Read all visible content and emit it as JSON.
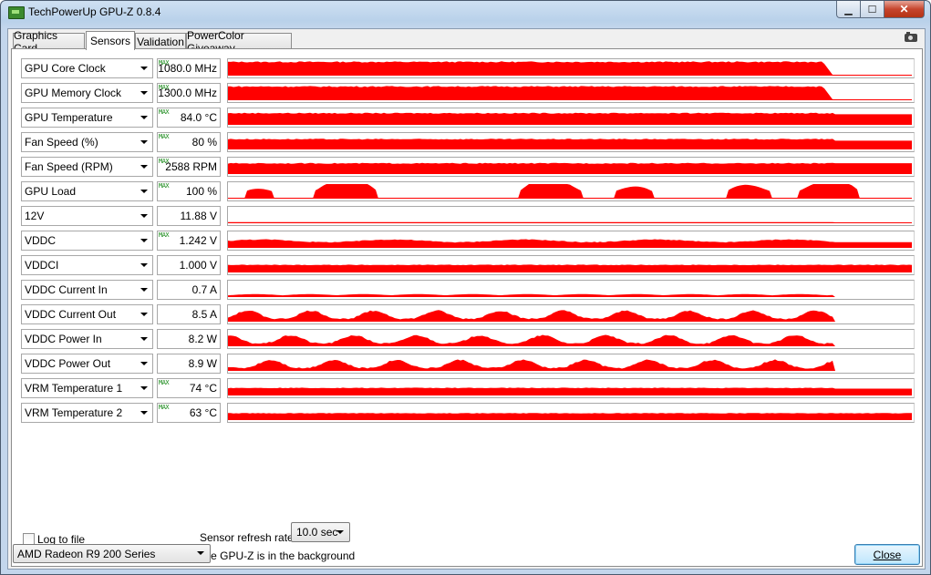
{
  "window": {
    "title": "TechPowerUp GPU-Z 0.8.4",
    "buttons": {
      "minimize": "▁",
      "maximize": "☐",
      "close": "✕"
    }
  },
  "tabs": [
    "Graphics Card",
    "Sensors",
    "Validation",
    "PowerColor Giveaway"
  ],
  "active_tab": "Sensors",
  "max_tag": "MAX",
  "sensors": [
    {
      "name": "GPU Core Clock",
      "value": "1080.0 MHz",
      "max": true,
      "fill": 1.0,
      "trail": 0.18,
      "style": "flat",
      "tail": "drop",
      "graph_color": "#ff0000"
    },
    {
      "name": "GPU Memory Clock",
      "value": "1300.0 MHz",
      "max": true,
      "fill": 1.0,
      "trail": 0.2,
      "style": "flat",
      "tail": "drop",
      "graph_color": "#ff0000"
    },
    {
      "name": "GPU Temperature",
      "value": "84.0 °C",
      "max": true,
      "fill": 0.85,
      "trail": 0.3,
      "style": "flat",
      "tail": "step",
      "graph_color": "#ff0000"
    },
    {
      "name": "Fan Speed (%)",
      "value": "80 %",
      "max": true,
      "fill": 0.75,
      "trail": 0.25,
      "style": "flat",
      "tail": "step",
      "graph_color": "#ff0000"
    },
    {
      "name": "Fan Speed (RPM)",
      "value": "2588 RPM",
      "max": true,
      "fill": 0.78,
      "trail": 0.4,
      "style": "flat",
      "tail": "step",
      "graph_color": "#ff0000"
    },
    {
      "name": "GPU Load",
      "value": "100 %",
      "max": true,
      "fill": 1.0,
      "trail": 0.0,
      "style": "spiky",
      "tail": "none",
      "graph_color": "#ff0000"
    },
    {
      "name": "12V",
      "value": "11.88 V",
      "max": false,
      "fill": 0.08,
      "trail": 0.2,
      "style": "line",
      "tail": "step",
      "graph_color": "#ff0000"
    },
    {
      "name": "VDDC",
      "value": "1.242 V",
      "max": true,
      "fill": 0.6,
      "trail": 0.1,
      "style": "wavy",
      "tail": "step",
      "graph_color": "#ff0000"
    },
    {
      "name": "VDDCI",
      "value": "1.000 V",
      "max": false,
      "fill": 0.55,
      "trail": 0.55,
      "style": "flat",
      "tail": "none",
      "graph_color": "#ff0000"
    },
    {
      "name": "VDDC Current In",
      "value": "0.7 A",
      "max": false,
      "fill": 0.15,
      "trail": 0.0,
      "style": "lowwave",
      "tail": "end",
      "graph_color": "#ff0000"
    },
    {
      "name": "VDDC Current Out",
      "value": "8.5 A",
      "max": false,
      "fill": 0.6,
      "trail": 0.0,
      "style": "bumpy",
      "tail": "end",
      "graph_color": "#ff0000"
    },
    {
      "name": "VDDC Power In",
      "value": "8.2 W",
      "max": false,
      "fill": 0.6,
      "trail": 0.0,
      "style": "bumpy",
      "tail": "end",
      "graph_color": "#ff0000"
    },
    {
      "name": "VDDC Power Out",
      "value": "8.9 W",
      "max": false,
      "fill": 0.6,
      "trail": 0.0,
      "style": "bumpy",
      "tail": "end",
      "graph_color": "#ff0000"
    },
    {
      "name": "VRM Temperature 1",
      "value": "74 °C",
      "max": true,
      "fill": 0.55,
      "trail": 0.3,
      "style": "flat",
      "tail": "step",
      "graph_color": "#ff0000"
    },
    {
      "name": "VRM Temperature 2",
      "value": "63 °C",
      "max": true,
      "fill": 0.5,
      "trail": 0.5,
      "style": "flat",
      "tail": "none",
      "graph_color": "#ff0000"
    }
  ],
  "options": {
    "log_to_file": {
      "label": "Log to file",
      "checked": false
    },
    "continue_refresh": {
      "label": "Continue refreshing this screen while GPU-Z is in the background",
      "checked": true
    },
    "refresh_rate_label": "Sensor refresh rate:",
    "refresh_rate_value": "10.0 sec"
  },
  "footer": {
    "gpu_select_value": "AMD Radeon R9 200 Series",
    "close_label": "Close"
  }
}
